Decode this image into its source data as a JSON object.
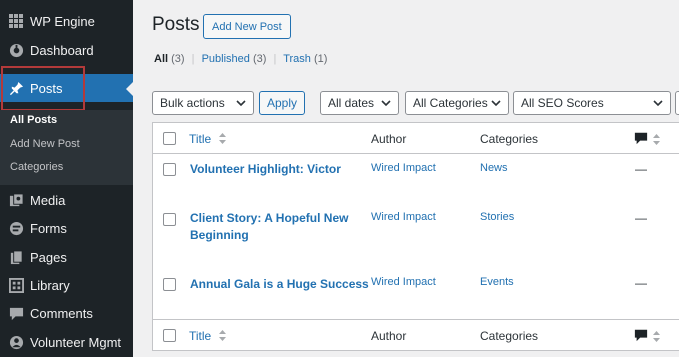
{
  "sidebar": {
    "items": [
      {
        "label": "WP Engine",
        "icon": "grid-icon"
      },
      {
        "label": "Dashboard",
        "icon": "dashboard-icon"
      },
      {
        "label": "Posts",
        "icon": "pin-icon"
      },
      {
        "label": "Media",
        "icon": "media-icon"
      },
      {
        "label": "Forms",
        "icon": "forms-icon"
      },
      {
        "label": "Pages",
        "icon": "pages-icon"
      },
      {
        "label": "Library",
        "icon": "library-icon"
      },
      {
        "label": "Comments",
        "icon": "comment-icon"
      },
      {
        "label": "Volunteer Mgmt",
        "icon": "people-icon"
      }
    ],
    "submenu": [
      "All Posts",
      "Add New Post",
      "Categories"
    ]
  },
  "header": {
    "title": "Posts",
    "add_new_label": "Add New Post"
  },
  "filters": {
    "all": "All",
    "all_count": "(3)",
    "published": "Published",
    "published_count": "(3)",
    "trash": "Trash",
    "trash_count": "(1)"
  },
  "toolbar": {
    "bulk_actions": "Bulk actions",
    "apply_label": "Apply",
    "dates": "All dates",
    "categories": "All Categories",
    "seo": "All SEO Scores"
  },
  "table": {
    "columns": {
      "title": "Title",
      "author": "Author",
      "categories": "Categories"
    },
    "rows": [
      {
        "title": "Volunteer Highlight: Victor",
        "author": "Wired Impact",
        "category": "News",
        "comments": "—"
      },
      {
        "title": "Client Story: A Hopeful New Beginning",
        "author": "Wired Impact",
        "category": "Stories",
        "comments": "—"
      },
      {
        "title": "Annual Gala is a Huge Success",
        "author": "Wired Impact",
        "category": "Events",
        "comments": "—"
      }
    ]
  },
  "colors": {
    "sidebar_bg": "#1d2327",
    "active": "#2271b1",
    "link": "#2271b1",
    "highlight_outline": "#b33a3a"
  }
}
